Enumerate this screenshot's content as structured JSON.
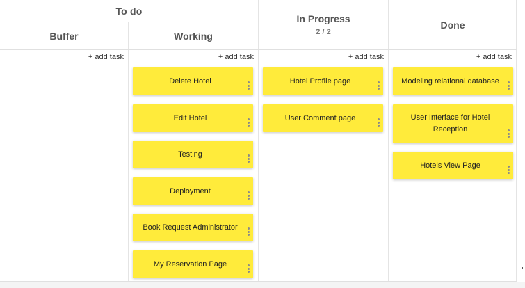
{
  "groups": {
    "todo": "To do"
  },
  "columns": {
    "buffer": {
      "title": "Buffer",
      "add_label": "+ add task",
      "cards": []
    },
    "working": {
      "title": "Working",
      "add_label": "+ add task",
      "cards": [
        "Delete Hotel",
        "Edit Hotel",
        "Testing",
        "Deployment",
        "Book Request Administrator",
        "My Reservation Page"
      ]
    },
    "inprogress": {
      "title": "In Progress",
      "count": "2 / 2",
      "add_label": "+ add task",
      "cards": [
        "Hotel Profile page",
        "User Comment page"
      ]
    },
    "done": {
      "title": "Done",
      "add_label": "+ add task",
      "cards": [
        "Modeling relational database",
        "User Interface for Hotel Reception",
        "Hotels View Page"
      ]
    }
  },
  "colors": {
    "card": "#ffeb3b",
    "border": "#e4e4e4",
    "menu_dots": "#8a8a8a"
  },
  "icons": {
    "card_menu": "more-vert-icon"
  }
}
